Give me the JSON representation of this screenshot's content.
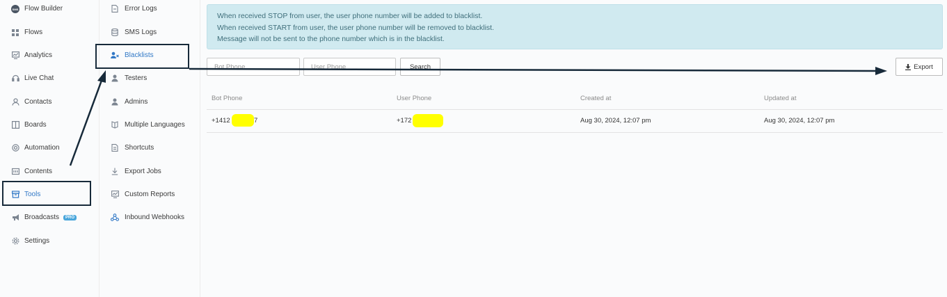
{
  "sidebar": {
    "items": [
      {
        "label": "Flow Builder",
        "icon": "sms-bubble-icon"
      },
      {
        "label": "Flows",
        "icon": "grid-icon"
      },
      {
        "label": "Analytics",
        "icon": "analytics-icon"
      },
      {
        "label": "Live Chat",
        "icon": "headset-icon"
      },
      {
        "label": "Contacts",
        "icon": "user-icon"
      },
      {
        "label": "Boards",
        "icon": "board-icon"
      },
      {
        "label": "Automation",
        "icon": "automation-icon"
      },
      {
        "label": "Contents",
        "icon": "contents-icon"
      },
      {
        "label": "Tools",
        "icon": "toolbox-icon"
      },
      {
        "label": "Broadcasts",
        "icon": "megaphone-icon",
        "badge": "PRO"
      },
      {
        "label": "Settings",
        "icon": "gear-icon"
      }
    ]
  },
  "subnav": {
    "items": [
      {
        "label": "Error Logs",
        "icon": "file-icon"
      },
      {
        "label": "SMS Logs",
        "icon": "database-icon"
      },
      {
        "label": "Blacklists",
        "icon": "user-block-icon",
        "active": true
      },
      {
        "label": "Testers",
        "icon": "person-icon"
      },
      {
        "label": "Admins",
        "icon": "person-icon"
      },
      {
        "label": "Multiple Languages",
        "icon": "language-icon"
      },
      {
        "label": "Shortcuts",
        "icon": "file-icon"
      },
      {
        "label": "Export Jobs",
        "icon": "download-icon"
      },
      {
        "label": "Custom Reports",
        "icon": "report-icon"
      },
      {
        "label": "Inbound Webhooks",
        "icon": "webhook-icon"
      }
    ]
  },
  "info": {
    "line1": "When received STOP from user, the user phone number will be added to blacklist.",
    "line2": "When received START from user, the user phone number will be removed to blacklist.",
    "line3": "Message will not be sent to the phone number which is in the blacklist."
  },
  "filters": {
    "bot_phone_placeholder": "Bot Phone",
    "user_phone_placeholder": "User Phone",
    "search_label": "Search",
    "export_label": "Export"
  },
  "table": {
    "headers": [
      "Bot Phone",
      "User Phone",
      "Created at",
      "Updated at"
    ],
    "rows": [
      {
        "bot_phone": "+1412",
        "bot_phone_tail": "7",
        "user_phone": "+172",
        "created": "Aug 30, 2024, 12:07 pm",
        "updated": "Aug 30, 2024, 12:07 pm"
      }
    ]
  },
  "colors": {
    "annotation": "#172a3a",
    "highlight": "#ffff00",
    "active": "#3178c6",
    "info_bg": "#d0eaf0"
  }
}
